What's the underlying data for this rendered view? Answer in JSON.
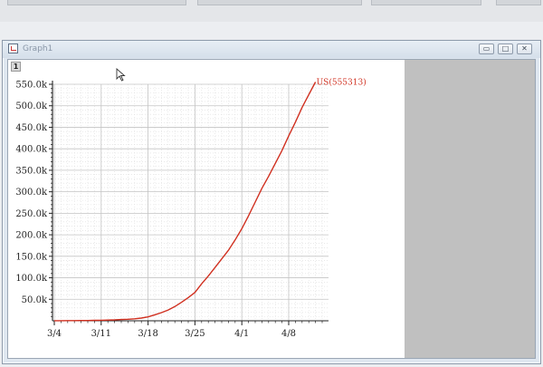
{
  "window": {
    "title": "Graph1",
    "layer_tab": "1",
    "buttons": [
      {
        "name": "minimize-button",
        "glyph": "▭"
      },
      {
        "name": "maximize-button",
        "glyph": "□"
      },
      {
        "name": "close-button",
        "glyph": "✕"
      }
    ]
  },
  "chart_data": {
    "type": "line",
    "x_ticks": [
      "3/4",
      "3/11",
      "3/18",
      "3/25",
      "4/1",
      "4/8"
    ],
    "y_ticks": [
      "50.0k",
      "100.0k",
      "150.0k",
      "200.0k",
      "250.0k",
      "300.0k",
      "350.0k",
      "400.0k",
      "450.0k",
      "500.0k",
      "550.0k"
    ],
    "xlim": [
      "3/4",
      "4/14"
    ],
    "ylim": [
      0,
      550000
    ],
    "grid": true,
    "series": [
      {
        "name": "US(555313)",
        "color": "#d03020",
        "x": [
          "3/4",
          "3/5",
          "3/6",
          "3/7",
          "3/8",
          "3/9",
          "3/10",
          "3/11",
          "3/12",
          "3/13",
          "3/14",
          "3/15",
          "3/16",
          "3/17",
          "3/18",
          "3/19",
          "3/20",
          "3/21",
          "3/22",
          "3/23",
          "3/24",
          "3/25",
          "3/26",
          "3/27",
          "3/28",
          "3/29",
          "3/30",
          "3/31",
          "4/1",
          "4/2",
          "4/3",
          "4/4",
          "4/5",
          "4/6",
          "4/7",
          "4/8",
          "4/9",
          "4/10",
          "4/11",
          "4/12"
        ],
        "values": [
          150,
          220,
          320,
          420,
          540,
          720,
          960,
          1300,
          1650,
          2200,
          2900,
          3500,
          4600,
          6400,
          9000,
          14000,
          19000,
          25000,
          33000,
          43000,
          54000,
          66000,
          86000,
          104000,
          124000,
          144000,
          164000,
          188000,
          214000,
          244000,
          276000,
          308000,
          336000,
          366000,
          396000,
          430000,
          462000,
          496000,
          526000,
          555313
        ]
      }
    ]
  }
}
